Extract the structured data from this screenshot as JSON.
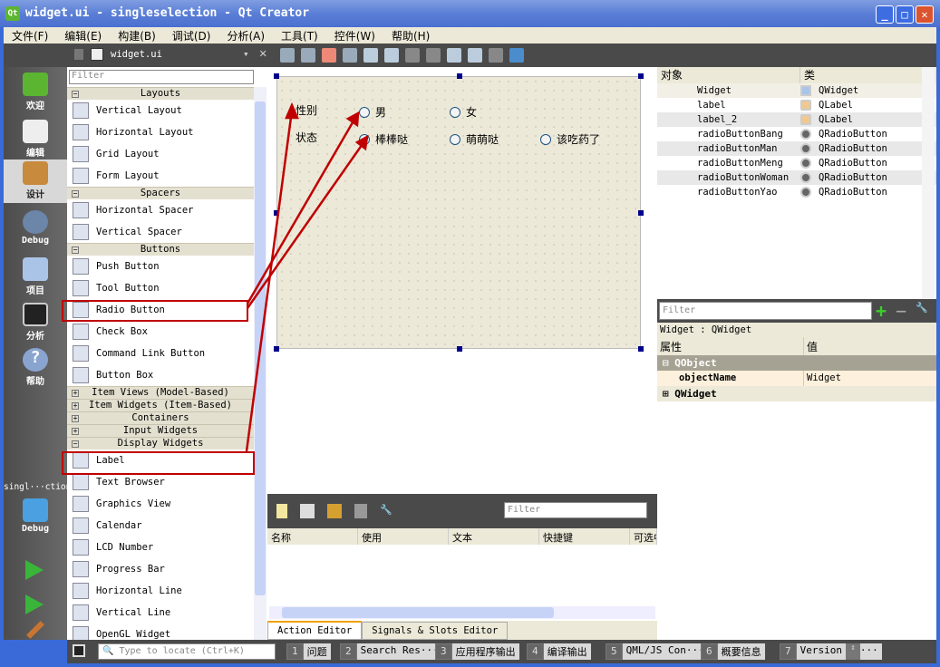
{
  "window": {
    "title": "widget.ui - singleselection - Qt Creator",
    "logo": "Qt",
    "controls": [
      "minimize",
      "maximize",
      "close"
    ]
  },
  "menu": [
    "文件(F)",
    "编辑(E)",
    "构建(B)",
    "调试(D)",
    "分析(A)",
    "工具(T)",
    "控件(W)",
    "帮助(H)"
  ],
  "editor_toolbar": {
    "file": "widget.ui"
  },
  "modes": [
    {
      "label": "欢迎",
      "icon": "qt-logo-icon"
    },
    {
      "label": "编辑",
      "icon": "document-icon"
    },
    {
      "label": "设计",
      "icon": "design-icon",
      "selected": true
    },
    {
      "label": "Debug",
      "icon": "bug-icon"
    },
    {
      "label": "项目",
      "icon": "folder-icon"
    },
    {
      "label": "分析",
      "icon": "analyze-icon"
    },
    {
      "label": "帮助",
      "icon": "help-icon"
    }
  ],
  "kit": {
    "project": "singl···ction",
    "config": "Debug"
  },
  "widget_box": {
    "filter_placeholder": "Filter",
    "sections": [
      {
        "title": "Layouts",
        "expanded": true,
        "items": [
          "Vertical Layout",
          "Horizontal Layout",
          "Grid Layout",
          "Form Layout"
        ]
      },
      {
        "title": "Spacers",
        "expanded": true,
        "items": [
          "Horizontal Spacer",
          "Vertical Spacer"
        ]
      },
      {
        "title": "Buttons",
        "expanded": true,
        "items": [
          "Push Button",
          "Tool Button",
          "Radio Button",
          "Check Box",
          "Command Link Button",
          "Button Box"
        ]
      },
      {
        "title": "Item Views (Model-Based)",
        "expanded": false,
        "items": []
      },
      {
        "title": "Item Widgets (Item-Based)",
        "expanded": false,
        "items": []
      },
      {
        "title": "Containers",
        "expanded": false,
        "items": []
      },
      {
        "title": "Input Widgets",
        "expanded": false,
        "items": []
      },
      {
        "title": "Display Widgets",
        "expanded": true,
        "items": [
          "Label",
          "Text Browser",
          "Graphics View",
          "Calendar",
          "LCD Number",
          "Progress Bar",
          "Horizontal Line",
          "Vertical Line",
          "OpenGL Widget"
        ]
      }
    ]
  },
  "form": {
    "labels": [
      "性别",
      "状态"
    ],
    "radios_row1": [
      "男",
      "女"
    ],
    "radios_row2": [
      "棒棒哒",
      "萌萌哒",
      "该吃药了"
    ]
  },
  "action_editor": {
    "filter_placeholder": "Filter",
    "columns": [
      "名称",
      "使用",
      "文本",
      "快捷键",
      "可选中"
    ],
    "tabs": [
      "Action Editor",
      "Signals & Slots Editor"
    ]
  },
  "object_inspector": {
    "columns": [
      "对象",
      "类"
    ],
    "rows": [
      {
        "name": "Widget",
        "class": "QWidget"
      },
      {
        "name": "label",
        "class": "QLabel"
      },
      {
        "name": "label_2",
        "class": "QLabel"
      },
      {
        "name": "radioButtonBang",
        "class": "QRadioButton"
      },
      {
        "name": "radioButtonMan",
        "class": "QRadioButton"
      },
      {
        "name": "radioButtonMeng",
        "class": "QRadioButton"
      },
      {
        "name": "radioButtonWoman",
        "class": "QRadioButton"
      },
      {
        "name": "radioButtonYao",
        "class": "QRadioButton"
      }
    ]
  },
  "property_editor": {
    "filter_placeholder": "Filter",
    "context": "Widget : QWidget",
    "columns": [
      "属性",
      "值"
    ],
    "group1": "QObject",
    "prop_name": "objectName",
    "prop_value": "Widget",
    "group2": "QWidget"
  },
  "status": {
    "locate_placeholder": "Type to locate (Ctrl+K)",
    "panes": [
      {
        "n": "1",
        "l": "问题"
      },
      {
        "n": "2",
        "l": "Search Res···"
      },
      {
        "n": "3",
        "l": "应用程序输出"
      },
      {
        "n": "4",
        "l": "编译输出"
      },
      {
        "n": "5",
        "l": "QML/JS Con···"
      },
      {
        "n": "6",
        "l": "概要信息"
      },
      {
        "n": "7",
        "l": "Version Co···"
      }
    ]
  },
  "annotation_color": "#c00000"
}
